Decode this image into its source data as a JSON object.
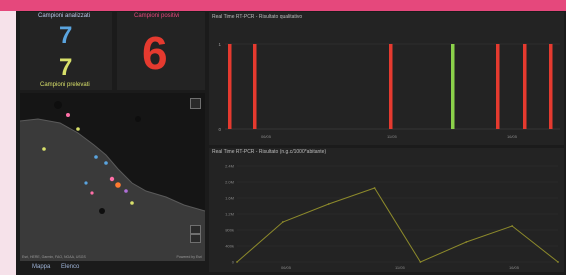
{
  "dashboard": {
    "counts": {
      "analyzed_label": "Campioni analizzati",
      "analyzed_value": "7",
      "pooled_value": "7",
      "pooled_label": "Campioni prelevati"
    },
    "positives": {
      "label": "Campioni positivi",
      "value": "6"
    },
    "map": {
      "credit": "Esri, HERE, Garmin, FAO, NOAA, USGS",
      "powered": "Powered by Esri"
    },
    "tabs": [
      {
        "label": "Mappa"
      },
      {
        "label": "Elenco"
      }
    ],
    "colors": {
      "accent_pink": "#e5487c",
      "positive_red": "#e53a2f",
      "negative_green": "#8bd14a",
      "analyzed_blue": "#5aa4df",
      "pooled_yellow": "#d8e06a",
      "line_olive": "#8d8a2b"
    }
  },
  "chart_data": [
    {
      "type": "bar",
      "title": "Real Time RT-PCR - Risultato qualitativo",
      "y_ticks": [
        "0",
        "1"
      ],
      "x_ticks": [
        "06/05",
        "11/05",
        "16/05"
      ],
      "series": [
        {
          "color": "red",
          "values": [
            1,
            1,
            1,
            1,
            1,
            1
          ]
        },
        {
          "color": "green",
          "values": [
            1
          ]
        }
      ]
    },
    {
      "type": "line",
      "title": "Real Time RT-PCR - Risultato (n.g.c/1000*abitante)",
      "y_ticks": [
        "0",
        "400k",
        "800k",
        "1.2M",
        "1.6M",
        "2.0M",
        "2.4M"
      ],
      "x_ticks": [
        "06/05",
        "11/05",
        "16/05"
      ],
      "ylim": [
        0,
        2600000
      ],
      "values": [
        0,
        1000000,
        1450000,
        1850000,
        0,
        500000,
        900000,
        0
      ]
    }
  ]
}
